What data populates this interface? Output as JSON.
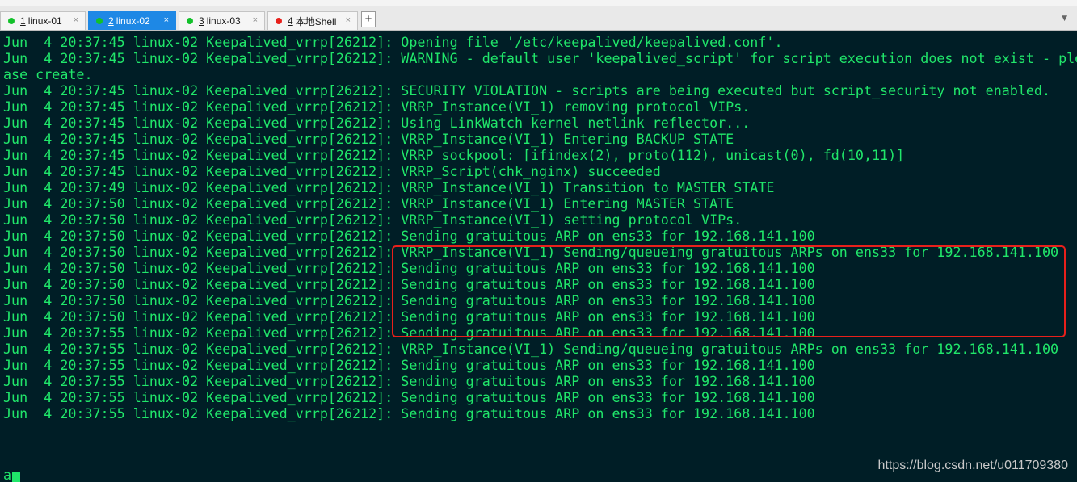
{
  "tabs": [
    {
      "number": "1",
      "label": "linux-01",
      "dot_color": "#12c12a",
      "active": false
    },
    {
      "number": "2",
      "label": "linux-02",
      "dot_color": "#12c12a",
      "active": true
    },
    {
      "number": "3",
      "label": "linux-03",
      "dot_color": "#12c12a",
      "active": false
    },
    {
      "number": "4",
      "label": "本地Shell",
      "dot_color": "#e8201b",
      "active": false
    }
  ],
  "tab_close_glyph": "×",
  "new_tab_label": "+",
  "tab_menu_icon": "chevron-down-icon",
  "terminal": {
    "text_color": "#20e66a",
    "background": "#001e26",
    "lines": [
      "Jun  4 20:37:45 linux-02 Keepalived_vrrp[26212]: Opening file '/etc/keepalived/keepalived.conf'.",
      "Jun  4 20:37:45 linux-02 Keepalived_vrrp[26212]: WARNING - default user 'keepalived_script' for script execution does not exist - ple",
      "ase create.",
      "Jun  4 20:37:45 linux-02 Keepalived_vrrp[26212]: SECURITY VIOLATION - scripts are being executed but script_security not enabled.",
      "Jun  4 20:37:45 linux-02 Keepalived_vrrp[26212]: VRRP_Instance(VI_1) removing protocol VIPs.",
      "Jun  4 20:37:45 linux-02 Keepalived_vrrp[26212]: Using LinkWatch kernel netlink reflector...",
      "Jun  4 20:37:45 linux-02 Keepalived_vrrp[26212]: VRRP_Instance(VI_1) Entering BACKUP STATE",
      "Jun  4 20:37:45 linux-02 Keepalived_vrrp[26212]: VRRP sockpool: [ifindex(2), proto(112), unicast(0), fd(10,11)]",
      "Jun  4 20:37:45 linux-02 Keepalived_vrrp[26212]: VRRP_Script(chk_nginx) succeeded",
      "Jun  4 20:37:49 linux-02 Keepalived_vrrp[26212]: VRRP_Instance(VI_1) Transition to MASTER STATE",
      "Jun  4 20:37:50 linux-02 Keepalived_vrrp[26212]: VRRP_Instance(VI_1) Entering MASTER STATE",
      "Jun  4 20:37:50 linux-02 Keepalived_vrrp[26212]: VRRP_Instance(VI_1) setting protocol VIPs.",
      "Jun  4 20:37:50 linux-02 Keepalived_vrrp[26212]: Sending gratuitous ARP on ens33 for 192.168.141.100",
      "Jun  4 20:37:50 linux-02 Keepalived_vrrp[26212]: VRRP_Instance(VI_1) Sending/queueing gratuitous ARPs on ens33 for 192.168.141.100",
      "Jun  4 20:37:50 linux-02 Keepalived_vrrp[26212]: Sending gratuitous ARP on ens33 for 192.168.141.100",
      "Jun  4 20:37:50 linux-02 Keepalived_vrrp[26212]: Sending gratuitous ARP on ens33 for 192.168.141.100",
      "Jun  4 20:37:50 linux-02 Keepalived_vrrp[26212]: Sending gratuitous ARP on ens33 for 192.168.141.100",
      "Jun  4 20:37:50 linux-02 Keepalived_vrrp[26212]: Sending gratuitous ARP on ens33 for 192.168.141.100",
      "Jun  4 20:37:55 linux-02 Keepalived_vrrp[26212]: Sending gratuitous ARP on ens33 for 192.168.141.100",
      "Jun  4 20:37:55 linux-02 Keepalived_vrrp[26212]: VRRP_Instance(VI_1) Sending/queueing gratuitous ARPs on ens33 for 192.168.141.100",
      "Jun  4 20:37:55 linux-02 Keepalived_vrrp[26212]: Sending gratuitous ARP on ens33 for 192.168.141.100",
      "Jun  4 20:37:55 linux-02 Keepalived_vrrp[26212]: Sending gratuitous ARP on ens33 for 192.168.141.100",
      "Jun  4 20:37:55 linux-02 Keepalived_vrrp[26212]: Sending gratuitous ARP on ens33 for 192.168.141.100",
      "Jun  4 20:37:55 linux-02 Keepalived_vrrp[26212]: Sending gratuitous ARP on ens33 for 192.168.141.100"
    ],
    "prompt_input": "a",
    "highlight_color": "#e8201b"
  },
  "watermark": "https://blog.csdn.net/u011709380"
}
